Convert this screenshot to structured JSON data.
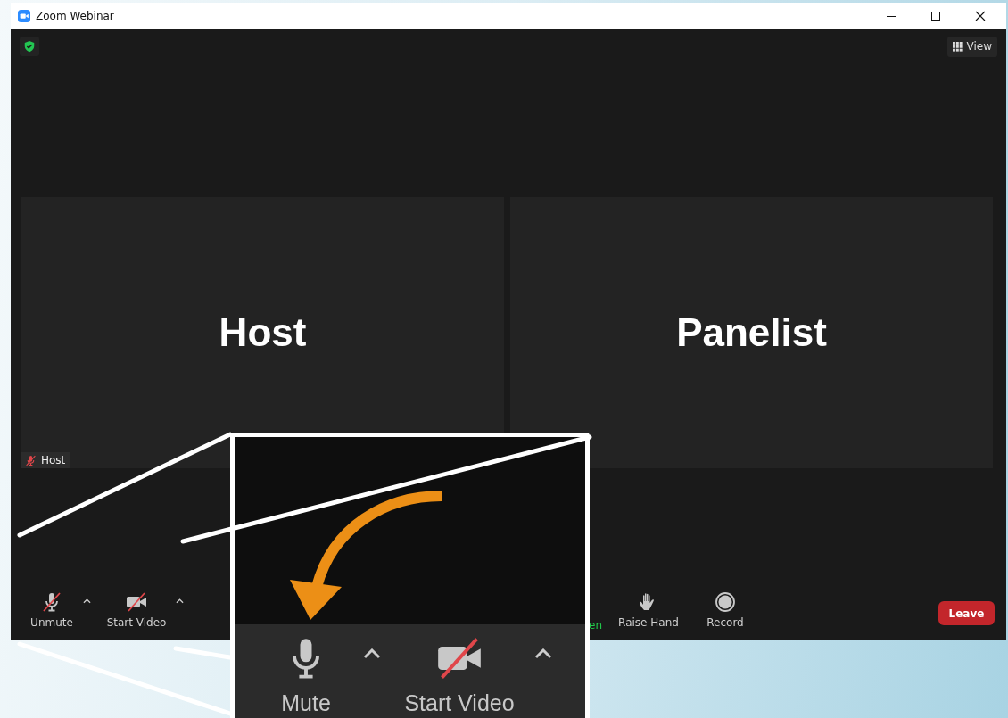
{
  "window": {
    "title": "Zoom Webinar"
  },
  "top_bar": {
    "view_button": "View"
  },
  "tiles": [
    {
      "name": "Host",
      "label": "Host",
      "muted": true
    },
    {
      "name": "Panelist"
    }
  ],
  "toolbar": {
    "items": [
      {
        "kind": "mic",
        "label": "Unmute",
        "muted": true,
        "menu": true
      },
      {
        "kind": "camera",
        "label": "Start Video",
        "muted": true,
        "menu": true
      },
      {
        "kind": "share_cut",
        "label": "en"
      },
      {
        "kind": "hand",
        "label": "Raise Hand"
      },
      {
        "kind": "record",
        "label": "Record"
      }
    ],
    "leave_button": "Leave"
  },
  "callout": {
    "items": [
      {
        "kind": "mic",
        "label": "Mute",
        "muted": false,
        "menu": true
      },
      {
        "kind": "camera",
        "label": "Start Video",
        "muted": true,
        "menu": true
      }
    ]
  }
}
